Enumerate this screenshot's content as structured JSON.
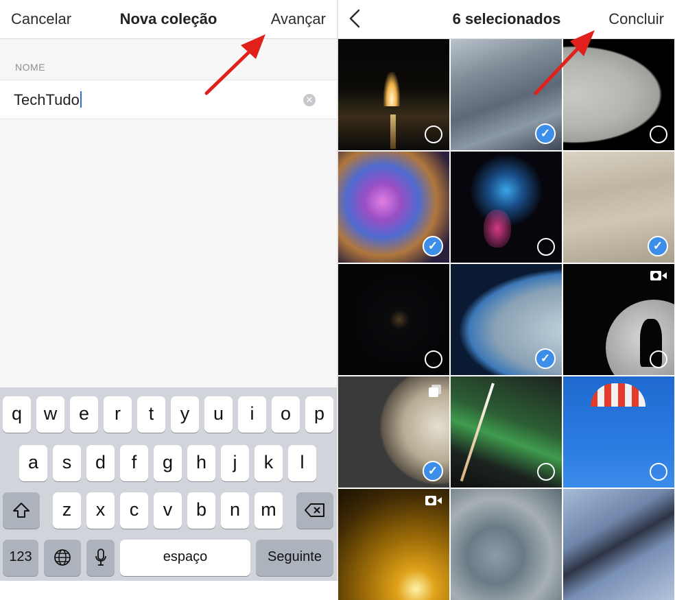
{
  "left_panel": {
    "nav": {
      "cancel": "Cancelar",
      "title": "Nova coleção",
      "next": "Avançar"
    },
    "field": {
      "label": "NOME",
      "value": "TechTudo"
    }
  },
  "keyboard": {
    "row1": [
      "q",
      "w",
      "e",
      "r",
      "t",
      "y",
      "u",
      "i",
      "o",
      "p"
    ],
    "row2": [
      "a",
      "s",
      "d",
      "f",
      "g",
      "h",
      "j",
      "k",
      "l"
    ],
    "row3": [
      "z",
      "x",
      "c",
      "v",
      "b",
      "n",
      "m"
    ],
    "numbers": "123",
    "space": "espaço",
    "next": "Seguinte"
  },
  "right_panel": {
    "back_icon": "chevron-left-icon",
    "title": "6 selecionados",
    "done": "Concluir",
    "photos": [
      {
        "name": "rocket-launch",
        "selected": false
      },
      {
        "name": "earth-clouds",
        "selected": true
      },
      {
        "name": "jupiter-edge",
        "selected": false
      },
      {
        "name": "nebula-colorful",
        "selected": true
      },
      {
        "name": "galaxy-cluster",
        "selected": false
      },
      {
        "name": "jupiter-clouds",
        "selected": true
      },
      {
        "name": "deep-field",
        "selected": false
      },
      {
        "name": "earth-limb",
        "selected": true
      },
      {
        "name": "moon-silhouette",
        "selected": false,
        "video": true
      },
      {
        "name": "exoplanet",
        "selected": true,
        "multiple": true
      },
      {
        "name": "aurora-launch",
        "selected": false
      },
      {
        "name": "parachutes",
        "selected": false
      },
      {
        "name": "sun-flare",
        "selected": false,
        "video": true
      },
      {
        "name": "jupiter-swirls",
        "selected": false
      },
      {
        "name": "mars-dunes",
        "selected": false
      }
    ]
  },
  "colors": {
    "check": "#3d8ee8",
    "arrow": "#e0201b"
  }
}
